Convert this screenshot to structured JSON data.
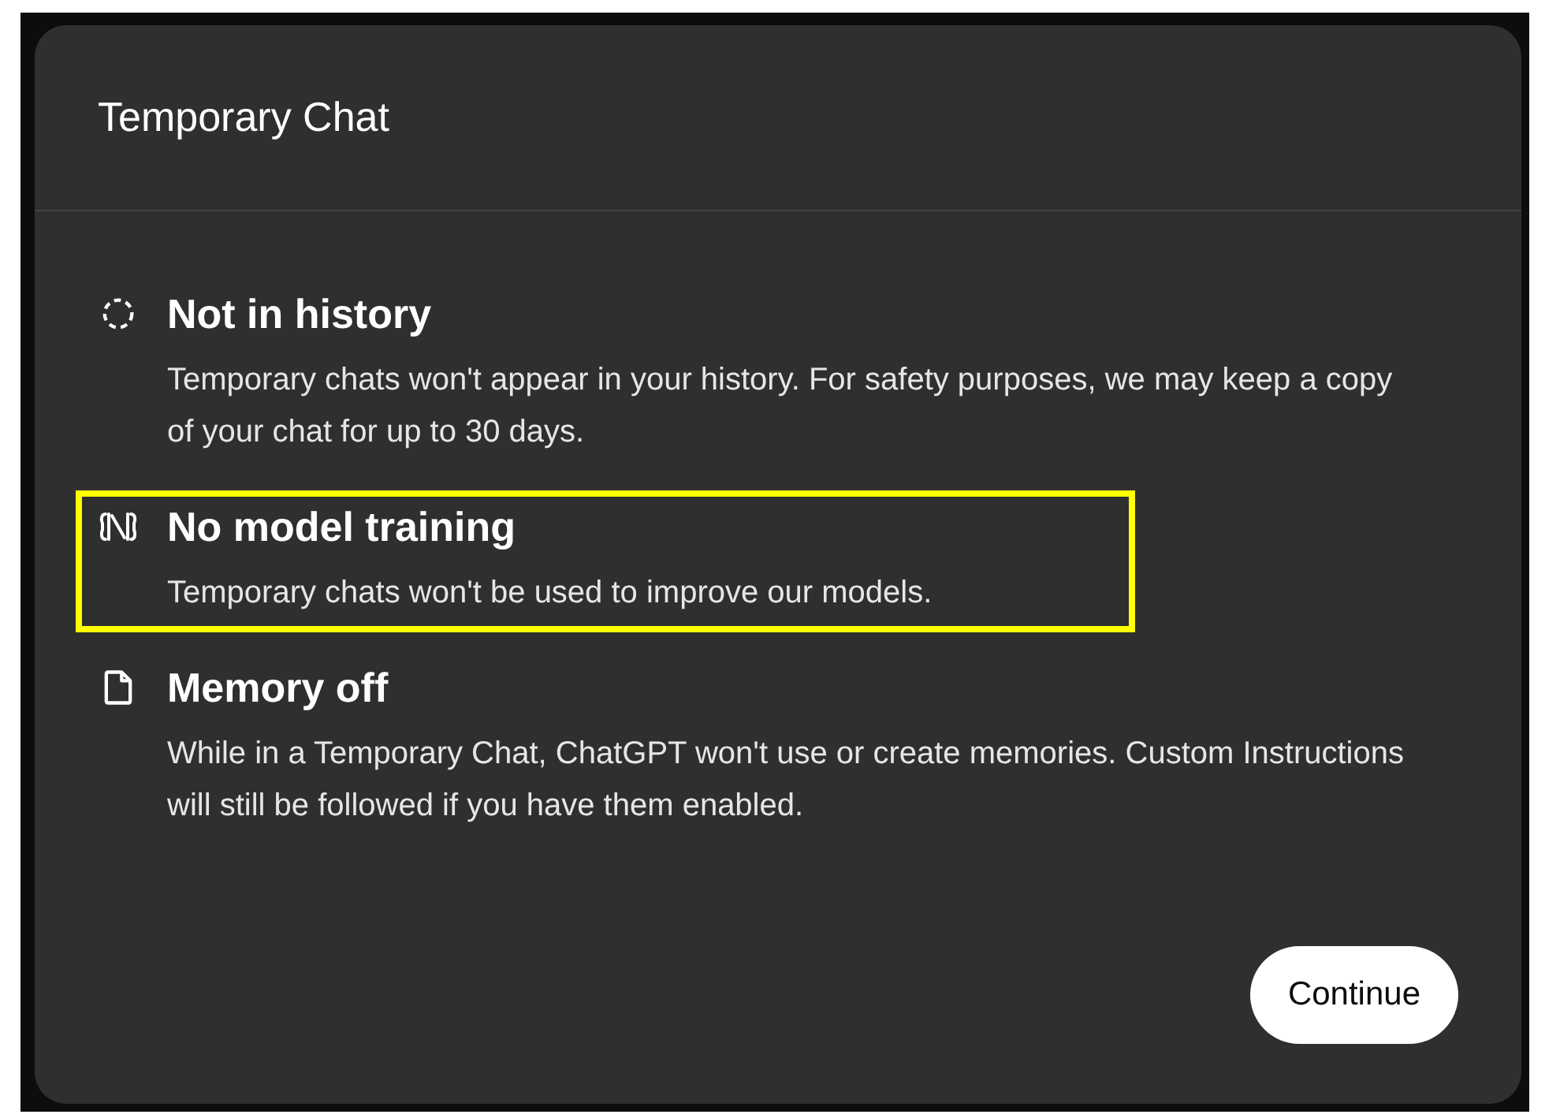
{
  "dialog": {
    "title": "Temporary Chat",
    "items": [
      {
        "kind": "dashed",
        "title": "Not in history",
        "text": "Temporary chats won't appear in your history. For safety purposes, we may keep a copy of your chat for up to 30 days.",
        "highlighted": false
      },
      {
        "kind": "training",
        "title": "No model training",
        "text": "Temporary chats won't be used to improve our models.",
        "highlighted": true
      },
      {
        "kind": "memory",
        "title": "Memory off",
        "text": "While in a Temporary Chat, ChatGPT won't use or create memories. Custom Instructions will still be followed if you have them enabled.",
        "highlighted": false
      }
    ],
    "button": "Continue"
  }
}
